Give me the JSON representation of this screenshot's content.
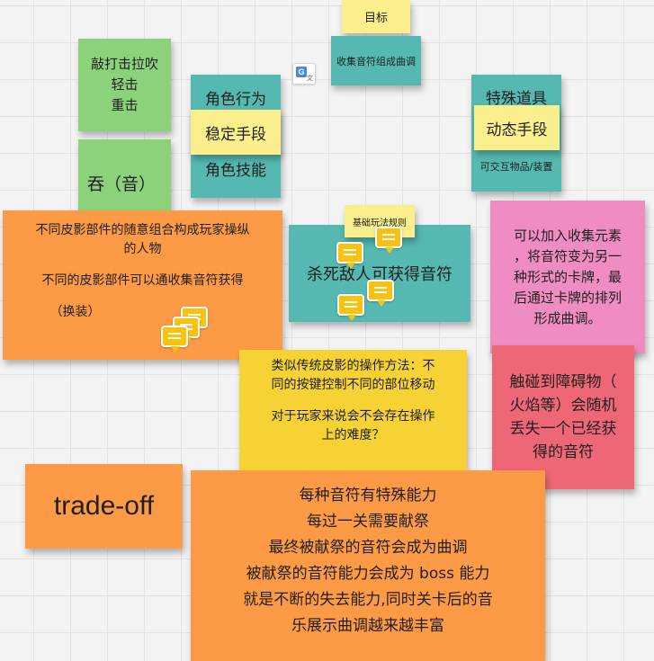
{
  "notes": {
    "goal": {
      "text": "目标"
    },
    "collect": {
      "text": "收集音符组成曲调"
    },
    "actions": {
      "lines": [
        "敲打击拉吹",
        "轻击",
        "重击"
      ]
    },
    "swallow": {
      "text": "吞（音）"
    },
    "role_behavior": {
      "text": "角色行为"
    },
    "stable_means": {
      "text": "稳定手段"
    },
    "role_skill": {
      "text": "角色技能"
    },
    "special_items": {
      "text": "特殊道具"
    },
    "dynamic_means": {
      "text": "动态手段"
    },
    "interactive_items": {
      "text": "可交互物品/装置"
    },
    "skin_parts": {
      "lines": [
        "不同皮影部件的随意组合构成玩家操纵",
        "的人物",
        "不同的皮影部件可以通收集音符获得",
        "（换装）"
      ]
    },
    "basic_rules": {
      "text": "基础玩法规则"
    },
    "kill_enemy": {
      "text": "杀死敌人可获得音符"
    },
    "card_collect": {
      "lines": [
        "可以加入收集元素",
        "，将音符变为另一",
        "种形式的卡牌，最",
        "后通过卡牌的排列",
        "形成曲调。"
      ]
    },
    "shadow_play": {
      "lines": [
        "类似传统皮影的操作方法：不",
        "同的按键控制不同的部位移动",
        "对于玩家来说会不会存在操作",
        "上的难度？"
      ]
    },
    "obstacle": {
      "lines": [
        "触碰到障碍物（",
        "火焰等）会随机",
        "丢失一个已经获",
        "得的音符"
      ]
    },
    "tradeoff": {
      "text": "trade-off"
    },
    "sacrifice": {
      "lines": [
        "每种音符有特殊能力",
        "每过一关需要献祭",
        "最终被献祭的音符会成为曲调",
        "被献祭的音符能力会成为 boss 能力",
        "就是不断的失去能力,同时关卡后的音",
        "乐展示曲调越来越丰富"
      ]
    }
  },
  "icons": {
    "translate": {
      "g": "G",
      "ja": "文"
    },
    "comments": [
      "comment-icon",
      "comment-icon",
      "comment-icon",
      "comment-icon",
      "comment-icon",
      "comment-icon",
      "comment-icon"
    ]
  },
  "colors": {
    "yellow": "#fbef8d",
    "green": "#8cd27a",
    "teal": "#55b9b1",
    "orange": "#fd9a45",
    "gold": "#f6d234",
    "pink": "#ef8cc2",
    "red": "#ee6777",
    "comment": "#f9c20f"
  }
}
